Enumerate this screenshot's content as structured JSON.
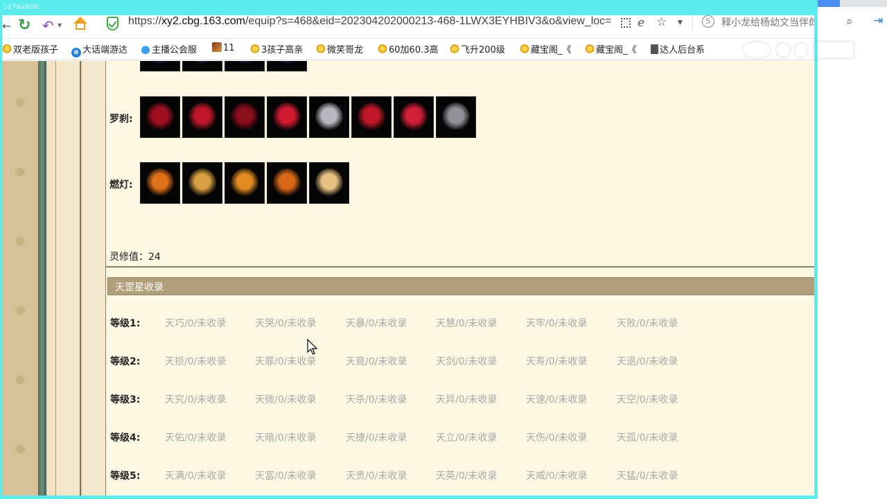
{
  "overlay": {
    "dimensions_label": "1076x606"
  },
  "browser": {
    "url_prefix": "https://",
    "url_host": "xy2.cbg.163.com",
    "url_rest": "/equip?s=468&eid=202304202000213-468-1LWX3EYHBIV3&o&view_loc=",
    "search_text": "释小龙给杨幼文当伴郎"
  },
  "bookmarks": [
    {
      "label": "双老版孩子",
      "icon": "star-icon"
    },
    {
      "label": "大话端游达",
      "icon": "ie-icon"
    },
    {
      "label": "主播公会服",
      "icon": "cloud-icon"
    },
    {
      "label": "11",
      "icon": "game-icon"
    },
    {
      "label": "3孩子高亲",
      "icon": "star-icon"
    },
    {
      "label": "微笑哥龙",
      "icon": "star-icon"
    },
    {
      "label": "60加60.3高",
      "icon": "star-icon"
    },
    {
      "label": "飞升200级",
      "icon": "star-icon"
    },
    {
      "label": "藏宝阁_《",
      "icon": "star-icon"
    },
    {
      "label": "藏宝阁_《",
      "icon": "star-icon"
    },
    {
      "label": "达人后台系",
      "icon": "doc-icon"
    }
  ],
  "equipment": {
    "rows": [
      {
        "label": "",
        "count": 4,
        "colors": [
          "#2a3a8c",
          "#3a4aa0",
          "#304099",
          "#2b3b90"
        ]
      },
      {
        "label": "罗刹:",
        "count": 8,
        "colors": [
          "#a01020",
          "#c0182a",
          "#8a0e1c",
          "#d01a30",
          "#b8b8c0",
          "#c01828",
          "#d02038",
          "#909098"
        ]
      },
      {
        "label": "燃灯:",
        "count": 5,
        "colors": [
          "#e0701a",
          "#d8a040",
          "#e08a20",
          "#d86818",
          "#e8c080"
        ]
      }
    ],
    "lingxiu_label": "灵修值：",
    "lingxiu_value": "24"
  },
  "tiangang": {
    "title": "天罡星收录",
    "levels": [
      {
        "label": "等级1:",
        "items": [
          "天巧/0/未收录",
          "天哭/0/未收录",
          "天暴/0/未收录",
          "天慧/0/未收录",
          "天牢/0/未收录",
          "天败/0/未收录"
        ]
      },
      {
        "label": "等级2:",
        "items": [
          "天损/0/未收录",
          "天罪/0/未收录",
          "天竟/0/未收录",
          "天剑/0/未收录",
          "天寿/0/未收录",
          "天退/0/未收录"
        ]
      },
      {
        "label": "等级3:",
        "items": [
          "天究/0/未收录",
          "天微/0/未收录",
          "天杀/0/未收录",
          "天异/0/未收录",
          "天速/0/未收录",
          "天空/0/未收录"
        ]
      },
      {
        "label": "等级4:",
        "items": [
          "天佑/0/未收录",
          "天暗/0/未收录",
          "天捷/0/未收录",
          "天立/0/未收录",
          "天伤/0/未收录",
          "天孤/0/未收录"
        ]
      },
      {
        "label": "等级5:",
        "items": [
          "天满/0/未收录",
          "天富/0/未收录",
          "天贵/0/未收录",
          "天英/0/未收录",
          "天威/0/未收录",
          "天猛/0/未收录"
        ]
      }
    ]
  }
}
